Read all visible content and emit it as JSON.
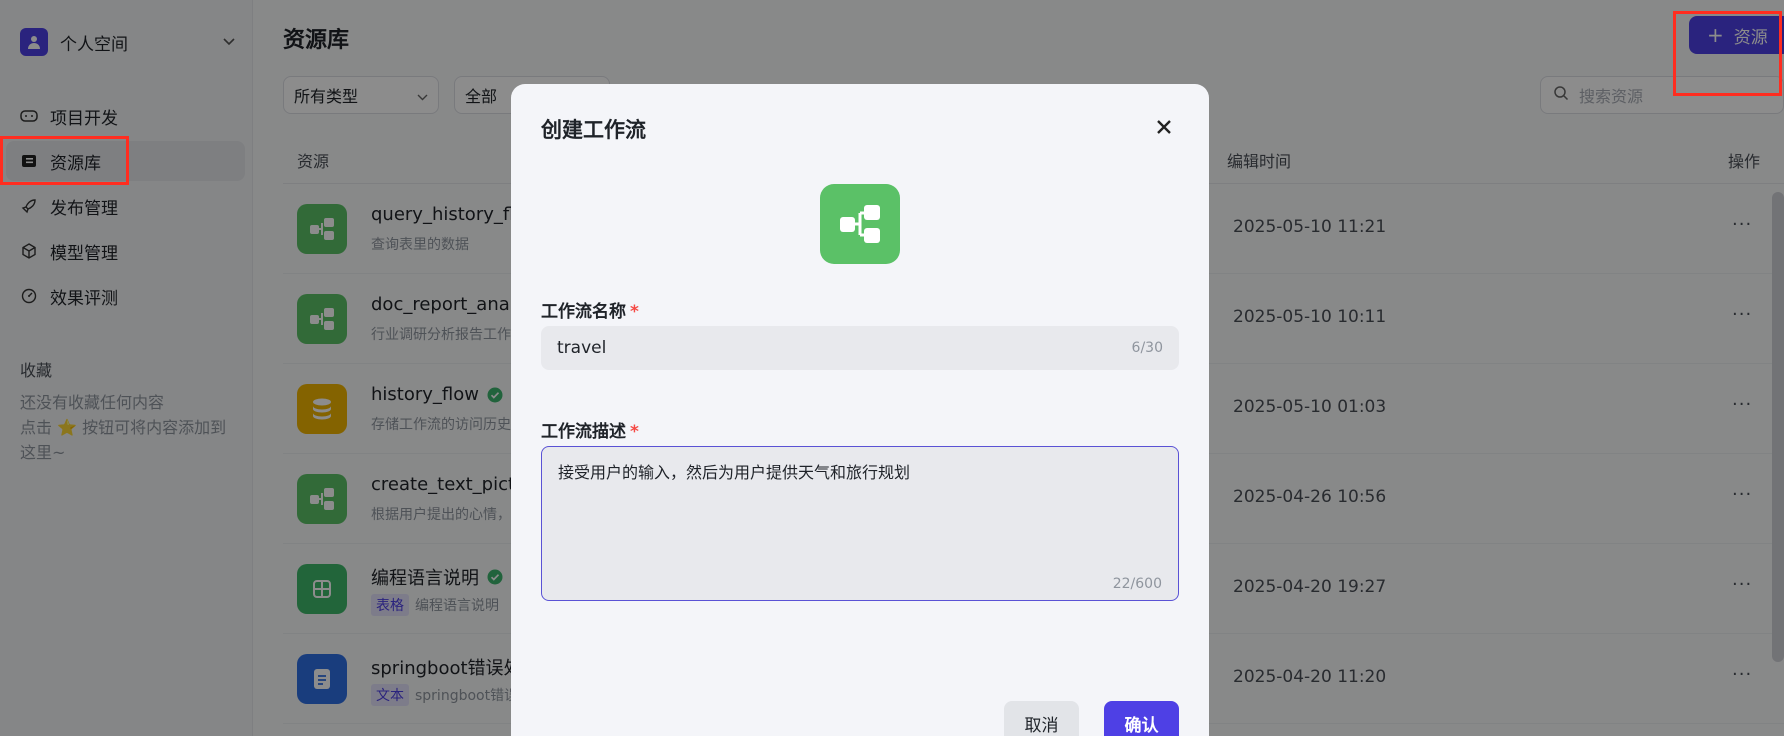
{
  "sidebar": {
    "space_name": "个人空间",
    "nav": [
      {
        "label": "项目开发",
        "icon": "gamepad-icon"
      },
      {
        "label": "资源库",
        "icon": "library-icon"
      },
      {
        "label": "发布管理",
        "icon": "rocket-icon"
      },
      {
        "label": "模型管理",
        "icon": "cube-icon"
      },
      {
        "label": "效果评测",
        "icon": "gauge-icon"
      }
    ],
    "favorites_title": "收藏",
    "favorites_empty_1": "还没有收藏任何内容",
    "favorites_empty_2": "点击 ⭐ 按钮可将内容添加到这里~"
  },
  "main": {
    "title": "资源库",
    "add_button": "资源",
    "filter_type": "所有类型",
    "filter_scope": "全部",
    "search_placeholder": "搜索资源",
    "columns": {
      "resource": "资源",
      "edit_time": "编辑时间",
      "actions": "操作"
    },
    "rows": [
      {
        "name": "query_history_flow",
        "desc": "查询表里的数据",
        "time": "2025-05-10 11:21",
        "icon": "workflow-icon",
        "color": "#5bc167"
      },
      {
        "name": "doc_report_analysis",
        "desc": "行业调研分析报告工作流",
        "time": "2025-05-10 10:11",
        "icon": "workflow-icon",
        "color": "#5bc167"
      },
      {
        "name": "history_flow",
        "desc": "存储工作流的访问历史",
        "time": "2025-05-10 01:03",
        "icon": "database-icon",
        "color": "#f0b400",
        "verified": true
      },
      {
        "name": "create_text_picture",
        "desc": "根据用户提出的心情，",
        "time": "2025-04-26 10:56",
        "icon": "workflow-icon",
        "color": "#5bc167"
      },
      {
        "name": "编程语言说明",
        "desc": "编程语言说明",
        "tag": "表格",
        "time": "2025-04-20 19:27",
        "icon": "table-icon",
        "color": "#3fb86b",
        "verified": true
      },
      {
        "name": "springboot错误处理",
        "desc": "springboot错误处理",
        "tag": "文本",
        "time": "2025-04-20 11:20",
        "icon": "document-icon",
        "color": "#2f6fe4"
      }
    ],
    "row_more": "···"
  },
  "modal": {
    "title": "创建工作流",
    "name_label": "工作流名称",
    "name_value": "travel",
    "name_counter": "6/30",
    "desc_label": "工作流描述",
    "desc_value": "接受用户的输入，然后为用户提供天气和旅行规划",
    "desc_counter": "22/600",
    "required_mark": "*",
    "cancel": "取消",
    "confirm": "确认"
  },
  "colors": {
    "accent": "#4e40e5",
    "highlight": "#ff2d20",
    "workflow_green": "#5bc167"
  }
}
